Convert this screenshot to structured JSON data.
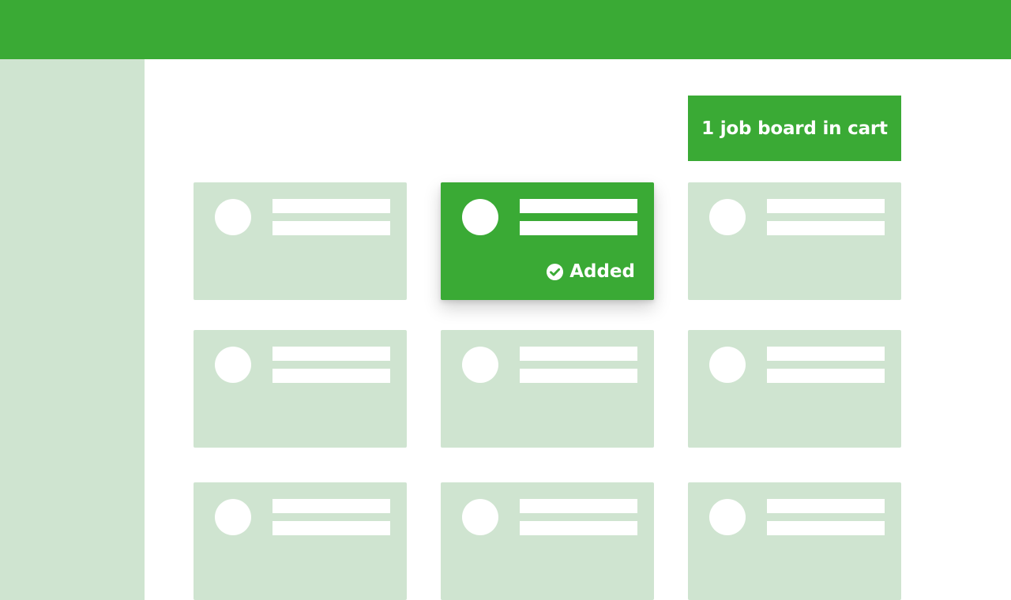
{
  "theme": {
    "primary_green": "#3aaa35",
    "light_green": "#cfe4d0",
    "white": "#ffffff"
  },
  "cart": {
    "label": "1 job board in cart"
  },
  "cards": [
    {
      "selected": false,
      "status": ""
    },
    {
      "selected": true,
      "status": "Added",
      "status_icon": "check-circle-icon"
    },
    {
      "selected": false,
      "status": ""
    },
    {
      "selected": false,
      "status": ""
    },
    {
      "selected": false,
      "status": ""
    },
    {
      "selected": false,
      "status": ""
    },
    {
      "selected": false,
      "status": ""
    },
    {
      "selected": false,
      "status": ""
    },
    {
      "selected": false,
      "status": ""
    }
  ]
}
